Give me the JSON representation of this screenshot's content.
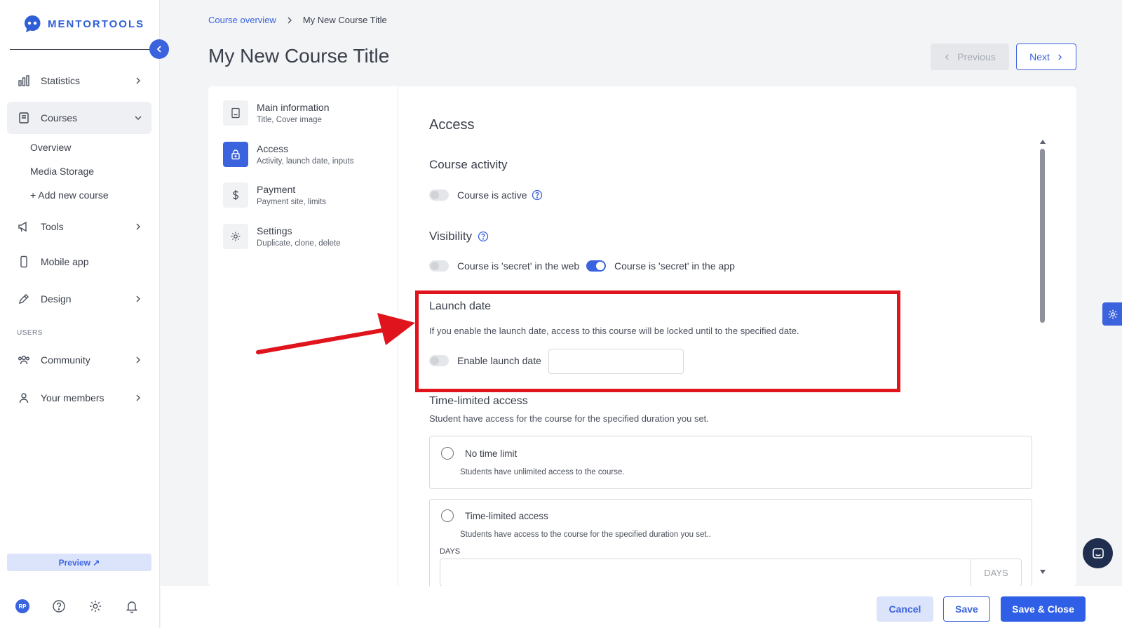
{
  "app": {
    "logo_text": "MENTORTOOLS"
  },
  "sidebar": {
    "items": [
      {
        "label": "Statistics",
        "icon": "bar-chart-icon"
      },
      {
        "label": "Courses",
        "icon": "book-icon"
      },
      {
        "label": "Tools",
        "icon": "megaphone-icon"
      },
      {
        "label": "Mobile app",
        "icon": "mobile-icon"
      },
      {
        "label": "Design",
        "icon": "pencil-icon"
      },
      {
        "label": "Community",
        "icon": "users-icon"
      },
      {
        "label": "Your members",
        "icon": "user-icon"
      }
    ],
    "courses_sub": [
      {
        "label": "Overview"
      },
      {
        "label": "Media Storage"
      },
      {
        "label": "+ Add new course"
      }
    ],
    "section_users": "USERS",
    "preview_label": "Preview ↗",
    "avatar_initials": "RP"
  },
  "header": {
    "breadcrumb_link": "Course overview",
    "breadcrumb_current": "My New Course Title",
    "title": "My New Course Title",
    "previous_label": "Previous",
    "next_label": "Next"
  },
  "steps": [
    {
      "title": "Main information",
      "desc": "Title, Cover image"
    },
    {
      "title": "Access",
      "desc": "Activity, launch date, inputs"
    },
    {
      "title": "Payment",
      "desc": "Payment site, limits"
    },
    {
      "title": "Settings",
      "desc": "Duplicate, clone, delete"
    }
  ],
  "access": {
    "title": "Access",
    "course_activity": {
      "heading": "Course activity",
      "toggle_label": "Course is active",
      "on": false
    },
    "visibility": {
      "heading": "Visibility",
      "web_label": "Course is 'secret' in the web",
      "web_on": false,
      "app_label": "Course is 'secret' in the app",
      "app_on": true
    },
    "launch_date": {
      "heading": "Launch date",
      "desc": "If you enable the launch date, access to this course will be locked until to the specified date.",
      "toggle_label": "Enable launch date",
      "on": false,
      "value": ""
    },
    "time_limited": {
      "heading": "Time-limited access",
      "desc": "Student have access for the course for the specified duration you set.",
      "options": [
        {
          "label": "No time limit",
          "desc": "Students have unlimited access to the course."
        },
        {
          "label": "Time-limited access",
          "desc": "Students have access to the course for the specified duration you set.."
        }
      ],
      "days_label": "DAYS",
      "days_suffix": "DAYS"
    }
  },
  "footer": {
    "cancel_label": "Cancel",
    "save_label": "Save",
    "save_close_label": "Save & Close"
  },
  "colors": {
    "accent": "#3b63dd",
    "highlight": "#e0141c"
  }
}
